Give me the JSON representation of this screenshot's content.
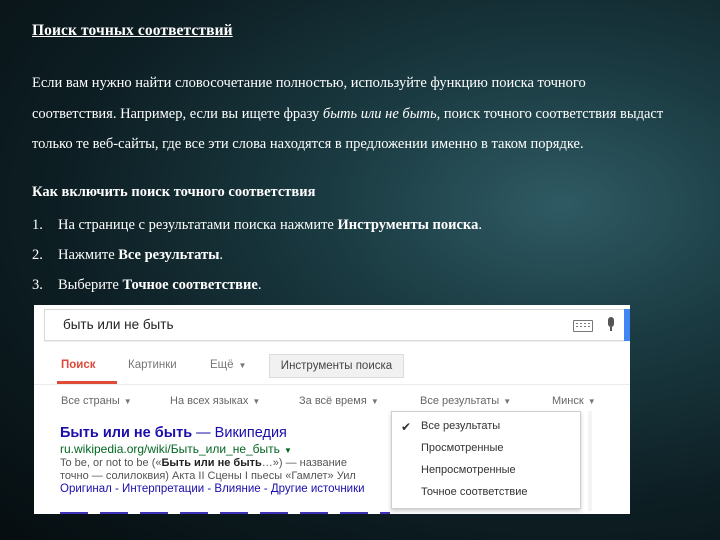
{
  "slide": {
    "heading": "Поиск точных соответствий",
    "paragraph": {
      "part1": "Если вам нужно найти словосочетание полностью, используйте функцию поиска точного соответствия. Например, если вы ищете фразу ",
      "example": "быть или не быть",
      "part2": ", поиск точного соответствия выдаст только те веб-сайты, где все эти слова находятся в предложении именно в таком порядке."
    },
    "subheading": "Как включить поиск точного соответствия",
    "steps": [
      {
        "number": "1.",
        "text": "На странице с результатами поиска нажмите ",
        "bold": "Инструменты поиска",
        "end": "."
      },
      {
        "number": "2.",
        "text": "Нажмите ",
        "bold": "Все результаты",
        "end": "."
      },
      {
        "number": "3.",
        "text": "Выберите ",
        "bold": "Точное соответствие",
        "end": "."
      }
    ]
  },
  "screenshot": {
    "search_query": "быть или не быть",
    "icons": {
      "keyboard": "keyboard-icon",
      "mic": "microphone-icon",
      "check": "checkmark-icon"
    },
    "colors": {
      "active_tab": "#dd4b39",
      "link": "#1a0dab",
      "url": "#006621",
      "accent": "#4285f4"
    },
    "tabs": {
      "search": "Поиск",
      "images": "Картинки",
      "more": "Ещё",
      "tools": "Инструменты поиска"
    },
    "filters": {
      "countries": "Все страны",
      "languages": "На всех языках",
      "time": "За всё время",
      "results": "Все результаты",
      "location": "Минск"
    },
    "result": {
      "title_bold": "Быть или не быть",
      "title_rest": " — Википедия",
      "url": "ru.wikipedia.org/wiki/Быть_или_не_быть",
      "snippet_line1_a": "To be, or not to be («",
      "snippet_line1_b": "Быть или не быть",
      "snippet_line1_c": "…») — название",
      "snippet_line2": "точно — солилоквия) Акта II Сцены I пьесы «Гамлет» Уил",
      "links": "Оригинал - Интерпретации - Влияние - Другие источники"
    },
    "dropdown_menu": {
      "items": [
        "Все результаты",
        "Просмотренные",
        "Непросмотренные",
        "Точное соответствие"
      ],
      "checked_item": "Все результаты"
    }
  }
}
